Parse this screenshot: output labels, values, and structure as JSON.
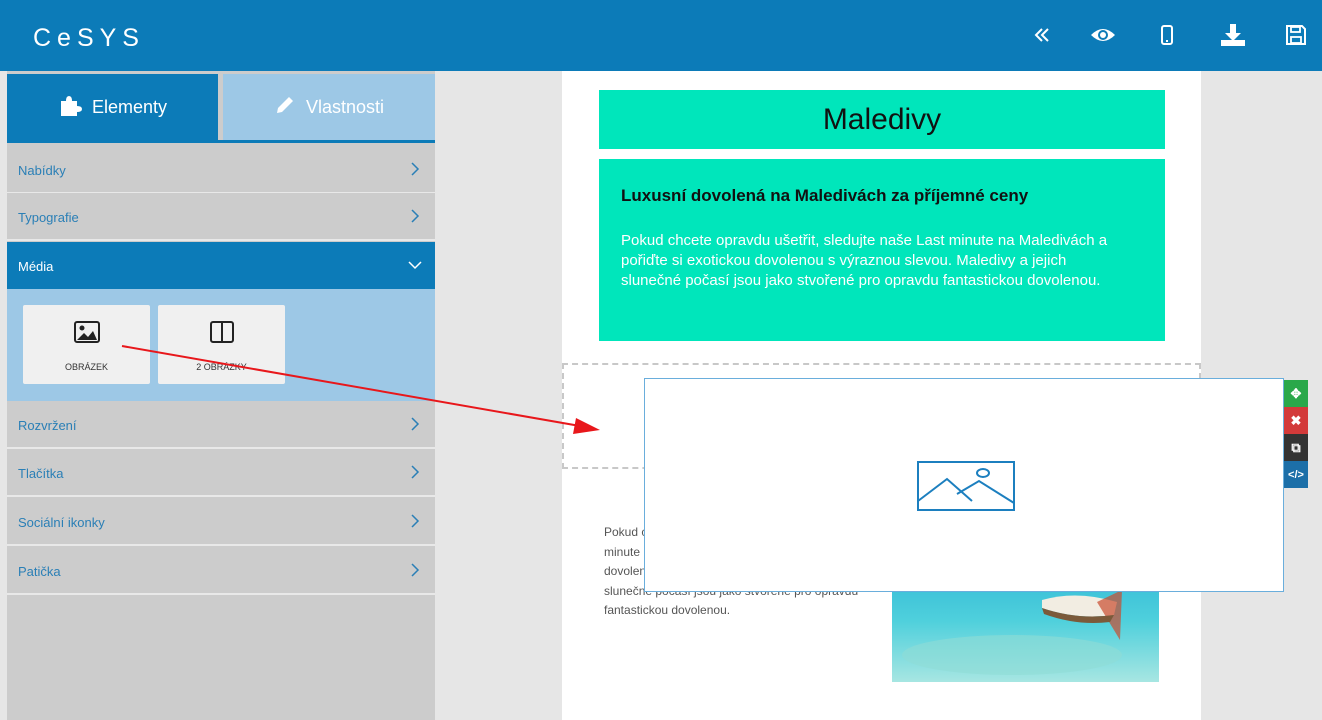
{
  "app": {
    "title": "CeSYS"
  },
  "toolbar": {
    "collapse_icon": "double-chevron-left-icon",
    "preview_icon": "eye-icon",
    "mobile_icon": "mobile-phone-icon",
    "download_icon": "download-icon",
    "save_icon": "floppy-disk-icon"
  },
  "sidebar": {
    "tabs": [
      {
        "label": "Elementy",
        "icon": "puzzle-icon",
        "active": true
      },
      {
        "label": "Vlastnosti",
        "icon": "pencil-icon",
        "active": false
      }
    ],
    "categories": [
      {
        "label": "Nabídky"
      },
      {
        "label": "Typografie"
      },
      {
        "label": "Média"
      },
      {
        "label": "Rozvržení"
      },
      {
        "label": "Tlačítka"
      },
      {
        "label": "Sociální ikonky"
      },
      {
        "label": "Patička"
      }
    ],
    "media_tiles": [
      {
        "label": "OBRÁZEK",
        "icon": "image-icon"
      },
      {
        "label": "2 OBRÁZKY",
        "icon": "two-columns-icon"
      }
    ]
  },
  "canvas": {
    "title": "Maledivy",
    "heading": "Luxusní dovolená na Maledivách za příjemné ceny",
    "paragraph": "Pokud chcete opravdu ušetřit, sledujte naše Last minute na Maledivách a pořiďte si exotickou dovolenou s výraznou slevou. Maledivy a jejich slunečné počasí jsou jako stvořené pro opravdu fantastickou dovolenou.",
    "body_text": "Pokud chcete opravdu ušetřit, sledujte naše Last minute na Maledivách a pořiďte si exotickou dovolenou s výraznou slevou. Maledivy a jejich slunečné počasí jsou jako stvořené pro opravdu fantastickou dovolenou.",
    "image_placeholder_icon": "image-placeholder-icon",
    "element_tools": [
      {
        "icon": "move-icon",
        "color": "#2aa84a"
      },
      {
        "icon": "close-icon",
        "color": "#d33a3a"
      },
      {
        "icon": "duplicate-icon",
        "color": "#333333"
      },
      {
        "icon": "code-icon",
        "color": "#1c6fa8"
      }
    ]
  },
  "colors": {
    "brand": "#0c7bb8",
    "accent": "#00e6bb",
    "sidebar_bg": "#cccccc",
    "media_panel": "#9dc8e6",
    "arrow": "#e8171b"
  }
}
